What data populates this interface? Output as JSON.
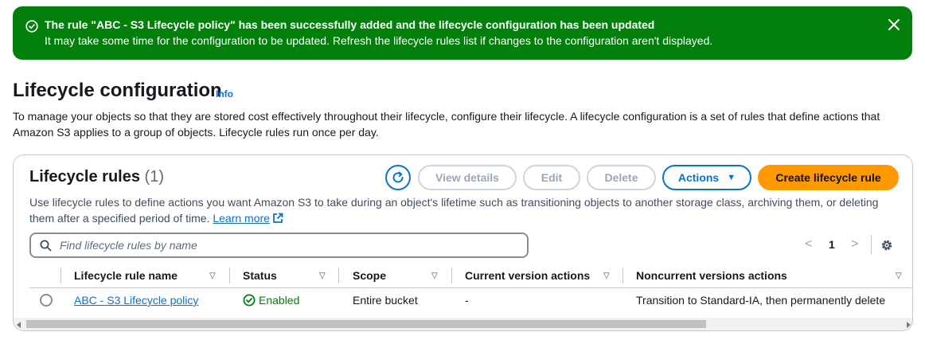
{
  "flash": {
    "title": "The rule \"ABC - S3 Lifecycle policy\" has been successfully added and the lifecycle configuration has been updated",
    "message": "It may take some time for the configuration to be updated. Refresh the lifecycle rules list if changes to the configuration aren't displayed.",
    "color": "#037f0c",
    "status_icon": "success-check-circle-icon",
    "dismiss_icon": "close-icon"
  },
  "header": {
    "title": "Lifecycle configuration",
    "info_label": "Info",
    "description": "To manage your objects so that they are stored cost effectively throughout their lifecycle, configure their lifecycle. A lifecycle configuration is a set of rules that define actions that Amazon S3 applies to a group of objects. Lifecycle rules run once per day."
  },
  "rules": {
    "title": "Lifecycle rules",
    "count": "(1)",
    "description": "Use lifecycle rules to define actions you want Amazon S3 to take during an object's lifetime such as transitioning objects to another storage class, archiving them, or deleting them after a specified period of time.",
    "learn_more": "Learn more",
    "buttons": {
      "view_details": "View details",
      "edit": "Edit",
      "delete": "Delete",
      "actions": "Actions",
      "create": "Create lifecycle rule"
    },
    "search_placeholder": "Find lifecycle rules by name",
    "pagination": {
      "prev": "<",
      "page": "1",
      "next": ">"
    },
    "columns": [
      "Lifecycle rule name",
      "Status",
      "Scope",
      "Current version actions",
      "Noncurrent versions actions"
    ],
    "rows": [
      {
        "name": "ABC - S3 Lifecycle policy",
        "status": "Enabled",
        "scope": "Entire bucket",
        "current_actions": "-",
        "noncurrent_actions": "Transition to Standard-IA, then permanently delete"
      }
    ]
  },
  "colors": {
    "accent": "#0972d3",
    "primary_button": "#ff9900",
    "success": "#037f0c"
  }
}
